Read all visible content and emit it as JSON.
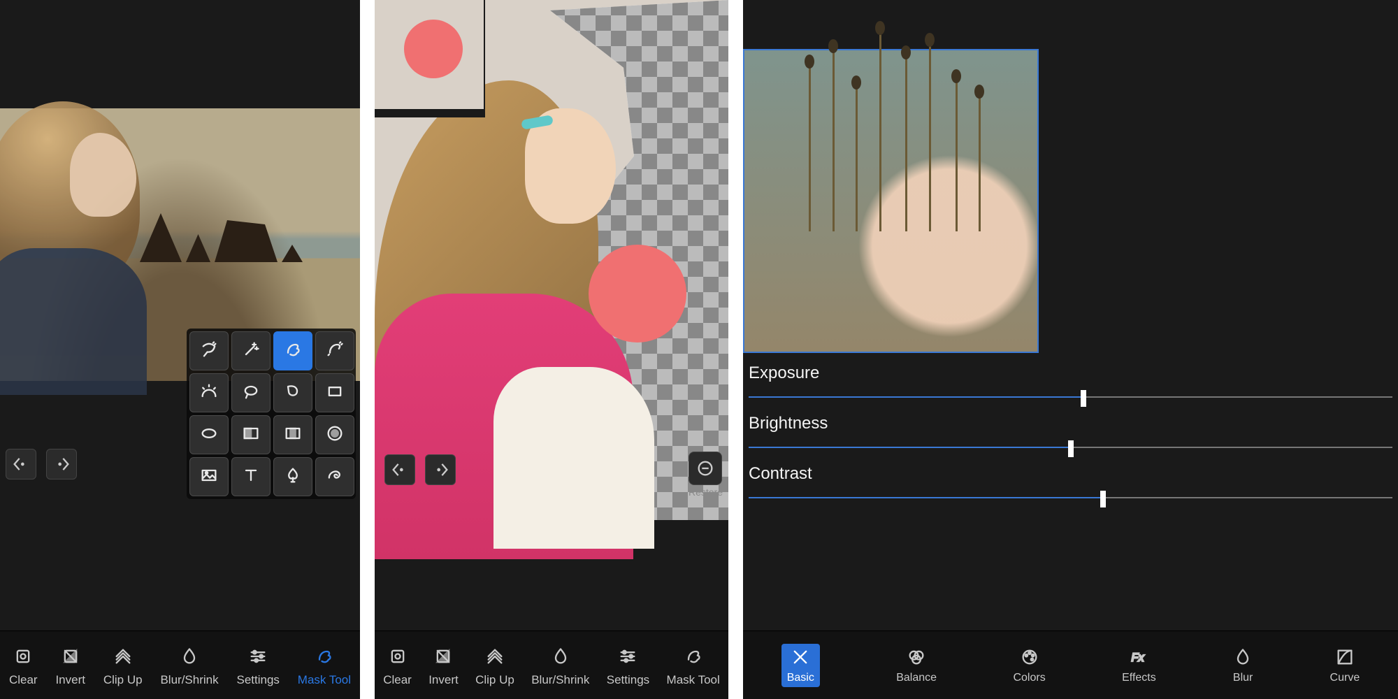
{
  "panel1": {
    "nav": {
      "undo": "undo",
      "redo": "redo"
    },
    "tool_grid": [
      "magic-lasso",
      "magic-wand",
      "brush",
      "sparkle-brush",
      "sun-arc",
      "lasso",
      "freeform",
      "rectangle",
      "ellipse",
      "gradient-horizontal",
      "gradient-mirror",
      "radial-gradient",
      "landscape",
      "text",
      "spade",
      "swirl"
    ],
    "tool_selected_index": 2,
    "bottom": [
      {
        "label": "Clear",
        "icon": "clear"
      },
      {
        "label": "Invert",
        "icon": "invert"
      },
      {
        "label": "Clip Up",
        "icon": "clip-up"
      },
      {
        "label": "Blur/Shrink",
        "icon": "blur-shrink"
      },
      {
        "label": "Settings",
        "icon": "settings"
      },
      {
        "label": "Mask Tool",
        "icon": "mask-tool"
      }
    ],
    "bottom_active_index": 5
  },
  "panel2": {
    "restore_label": "Restore",
    "bottom": [
      {
        "label": "Clear",
        "icon": "clear"
      },
      {
        "label": "Invert",
        "icon": "invert"
      },
      {
        "label": "Clip Up",
        "icon": "clip-up"
      },
      {
        "label": "Blur/Shrink",
        "icon": "blur-shrink"
      },
      {
        "label": "Settings",
        "icon": "settings"
      },
      {
        "label": "Mask Tool",
        "icon": "mask-tool"
      }
    ]
  },
  "panel4": {
    "sliders": [
      {
        "label": "Exposure",
        "percent": 52
      },
      {
        "label": "Brightness",
        "percent": 50
      },
      {
        "label": "Contrast",
        "percent": 55
      }
    ],
    "bottom": [
      {
        "label": "Basic",
        "icon": "basic"
      },
      {
        "label": "Balance",
        "icon": "balance"
      },
      {
        "label": "Colors",
        "icon": "colors"
      },
      {
        "label": "Effects",
        "icon": "effects"
      },
      {
        "label": "Blur",
        "icon": "blur"
      },
      {
        "label": "Curve",
        "icon": "curve"
      }
    ],
    "bottom_active_index": 0
  }
}
